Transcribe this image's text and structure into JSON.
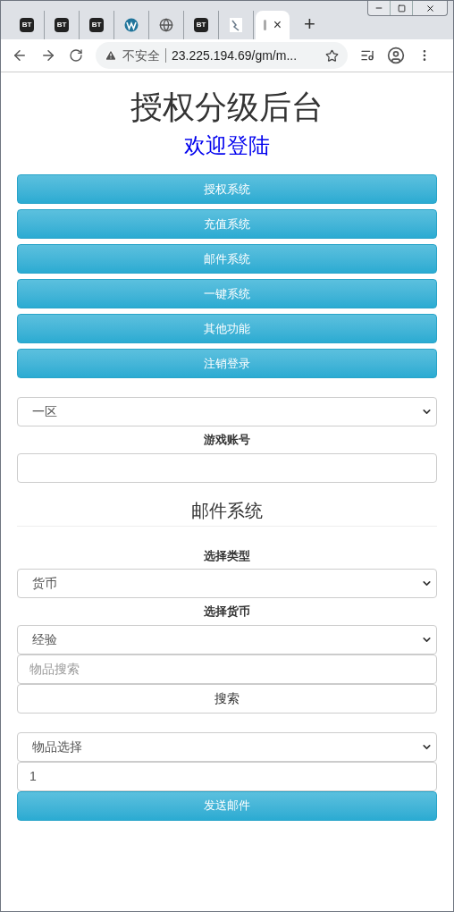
{
  "browser": {
    "tabs": [
      {
        "kind": "bt",
        "label": "BT",
        "selected": false
      },
      {
        "kind": "bt",
        "label": "BT",
        "selected": false
      },
      {
        "kind": "bt",
        "label": "BT",
        "selected": false
      },
      {
        "kind": "wordpress",
        "selected": false
      },
      {
        "kind": "globe",
        "selected": false
      },
      {
        "kind": "bt",
        "label": "BT",
        "selected": false
      },
      {
        "kind": "image",
        "selected": false
      },
      {
        "kind": "partial",
        "selected": true,
        "close": "×"
      }
    ],
    "new_tab": "+",
    "security": "不安全",
    "url": "23.225.194.69/gm/m..."
  },
  "page": {
    "title": "授权分级后台",
    "subtitle": "欢迎登陆",
    "nav_buttons": [
      "授权系统",
      "充值系统",
      "邮件系统",
      "一键系统",
      "其他功能",
      "注销登录"
    ],
    "form_sections": [
      [
        {
          "kind": "select",
          "value": "一区"
        },
        {
          "kind": "label",
          "text": "游戏账号"
        },
        {
          "kind": "input"
        },
        {
          "kind": "heading",
          "text": "邮件系统"
        },
        {
          "kind": "label",
          "text": "选择类型"
        },
        {
          "kind": "select",
          "value": "货币"
        },
        {
          "kind": "label",
          "text": "选择货币"
        },
        {
          "kind": "select",
          "value": "经验"
        },
        {
          "kind": "input",
          "placeholder": "物品搜索"
        },
        {
          "kind": "button",
          "text": "搜索"
        }
      ],
      [
        {
          "kind": "select",
          "value": "物品选择"
        },
        {
          "kind": "input",
          "value": "1"
        },
        {
          "kind": "primary",
          "text": "发送邮件"
        }
      ]
    ]
  }
}
